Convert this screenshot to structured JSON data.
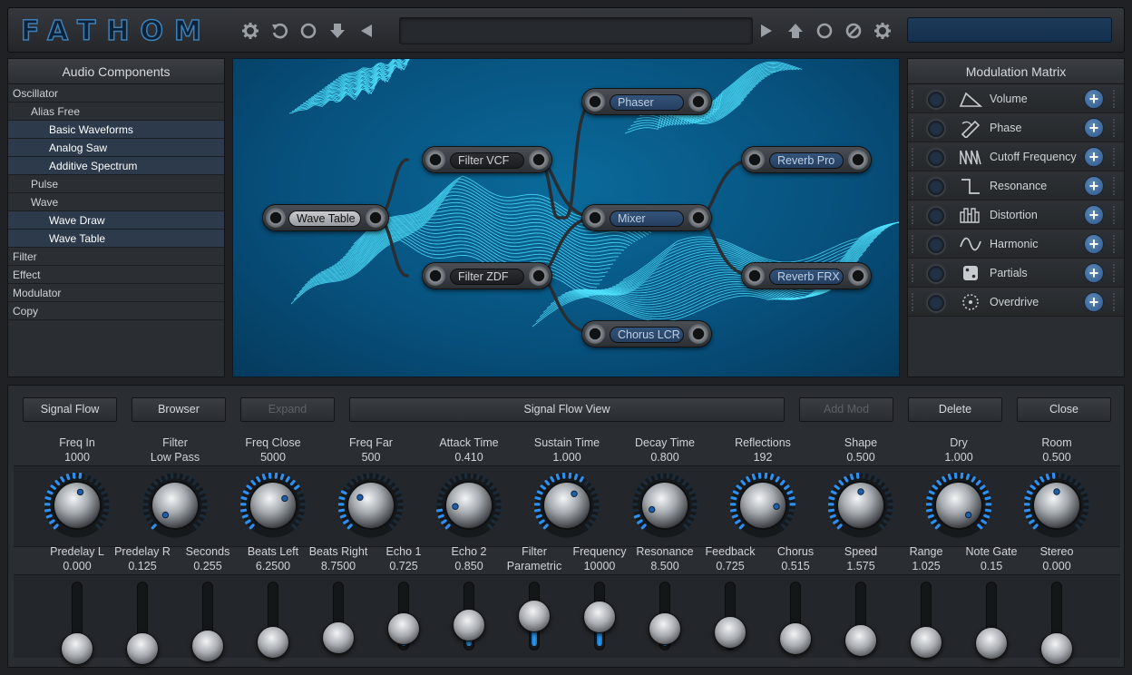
{
  "app": {
    "logo": "FATHOM"
  },
  "toolbar": {
    "left_icons": [
      "gear-icon",
      "undo-icon",
      "circle-icon",
      "download-arrow-icon",
      "left-triangle-icon"
    ],
    "right_icons": [
      "right-triangle-icon",
      "upload-arrow-icon",
      "circle-icon",
      "no-entry-icon",
      "gear-icon"
    ],
    "preset_name": ""
  },
  "components": {
    "title": "Audio Components",
    "items": [
      {
        "label": "Oscillator",
        "level": 0,
        "selected": false
      },
      {
        "label": "Alias Free",
        "level": 1,
        "selected": false
      },
      {
        "label": "Basic Waveforms",
        "level": 2,
        "selected": true
      },
      {
        "label": "Analog Saw",
        "level": 2,
        "selected": true
      },
      {
        "label": "Additive Spectrum",
        "level": 2,
        "selected": true
      },
      {
        "label": "Pulse",
        "level": 1,
        "selected": false
      },
      {
        "label": "Wave",
        "level": 1,
        "selected": false
      },
      {
        "label": "Wave Draw",
        "level": 2,
        "selected": true
      },
      {
        "label": "Wave Table",
        "level": 2,
        "selected": true
      },
      {
        "label": "Filter",
        "level": 0,
        "selected": false
      },
      {
        "label": "Effect",
        "level": 0,
        "selected": false
      },
      {
        "label": "Modulator",
        "level": 0,
        "selected": false
      },
      {
        "label": "Copy",
        "level": 0,
        "selected": false
      }
    ]
  },
  "nodes": [
    {
      "id": "wavetable",
      "label": "Wave Table",
      "style": "light"
    },
    {
      "id": "filtervcf",
      "label": "Filter VCF",
      "style": "dark"
    },
    {
      "id": "filterzdf",
      "label": "Filter ZDF",
      "style": "dark"
    },
    {
      "id": "phaser",
      "label": "Phaser",
      "style": "blue"
    },
    {
      "id": "mixer",
      "label": "Mixer",
      "style": "blue"
    },
    {
      "id": "chorus",
      "label": "Chorus LCR",
      "style": "blue"
    },
    {
      "id": "reverbpro",
      "label": "Reverb Pro",
      "style": "blue"
    },
    {
      "id": "reverbfrx",
      "label": "Reverb FRX",
      "style": "blue"
    }
  ],
  "modulation": {
    "title": "Modulation Matrix",
    "items": [
      {
        "label": "Volume",
        "icon": "envelope-icon"
      },
      {
        "label": "Phase",
        "icon": "pencil-icon"
      },
      {
        "label": "Cutoff Frequency",
        "icon": "sawtooth-icon"
      },
      {
        "label": "Resonance",
        "icon": "step-icon"
      },
      {
        "label": "Distortion",
        "icon": "bars-icon"
      },
      {
        "label": "Harmonic",
        "icon": "sine-icon"
      },
      {
        "label": "Partials",
        "icon": "dice-icon"
      },
      {
        "label": "Overdrive",
        "icon": "dial-icon"
      }
    ]
  },
  "bottom_buttons": [
    {
      "label": "Signal Flow",
      "enabled": true
    },
    {
      "label": "Browser",
      "enabled": true
    },
    {
      "label": "Expand",
      "enabled": false
    },
    {
      "label": "Signal Flow View",
      "enabled": true
    },
    {
      "label": "Add Mod",
      "enabled": false
    },
    {
      "label": "Delete",
      "enabled": true
    },
    {
      "label": "Close",
      "enabled": true
    }
  ],
  "knobs": [
    {
      "name": "Freq In",
      "value": "1000",
      "level": 0.55
    },
    {
      "name": "Filter",
      "value": "Low Pass",
      "level": 0.0
    },
    {
      "name": "Freq Close",
      "value": "5000",
      "level": 0.72
    },
    {
      "name": "Freq Far",
      "value": "500",
      "level": 0.3
    },
    {
      "name": "Attack Time",
      "value": "0.410",
      "level": 0.15
    },
    {
      "name": "Sustain Time",
      "value": "1.000",
      "level": 0.62
    },
    {
      "name": "Decay Time",
      "value": "0.800",
      "level": 0.1
    },
    {
      "name": "Reflections",
      "value": "192",
      "level": 0.85
    },
    {
      "name": "Shape",
      "value": "0.500",
      "level": 0.5
    },
    {
      "name": "Dry",
      "value": "1.000",
      "level": 1.0
    },
    {
      "name": "Room",
      "value": "0.500",
      "level": 0.5
    }
  ],
  "sliders": [
    {
      "name": "Predelay L",
      "value": "0.000",
      "level": 0.0
    },
    {
      "name": "Predelay R",
      "value": "0.125",
      "level": 0.0
    },
    {
      "name": "Seconds",
      "value": "0.255",
      "level": 0.06
    },
    {
      "name": "Beats Left",
      "value": "6.2500",
      "level": 0.13
    },
    {
      "name": "Beats Right",
      "value": "8.7500",
      "level": 0.23
    },
    {
      "name": "Echo 1",
      "value": "0.725",
      "level": 0.42
    },
    {
      "name": "Echo 2",
      "value": "0.850",
      "level": 0.5
    },
    {
      "name": "Filter\nParametric",
      "value": "",
      "level": 0.7
    },
    {
      "name": "Frequency",
      "value": "10000",
      "level": 0.68
    },
    {
      "name": "Resonance",
      "value": "8.500",
      "level": 0.43
    },
    {
      "name": "Feedback",
      "value": "0.725",
      "level": 0.35
    },
    {
      "name": "Chorus",
      "value": "0.515",
      "level": 0.22
    },
    {
      "name": "Speed",
      "value": "1.575",
      "level": 0.18
    },
    {
      "name": "Range",
      "value": "1.025",
      "level": 0.14
    },
    {
      "name": "Note Gate",
      "value": "0.15",
      "level": 0.12
    },
    {
      "name": "Stereo",
      "value": "0.000",
      "level": 0.0
    }
  ]
}
